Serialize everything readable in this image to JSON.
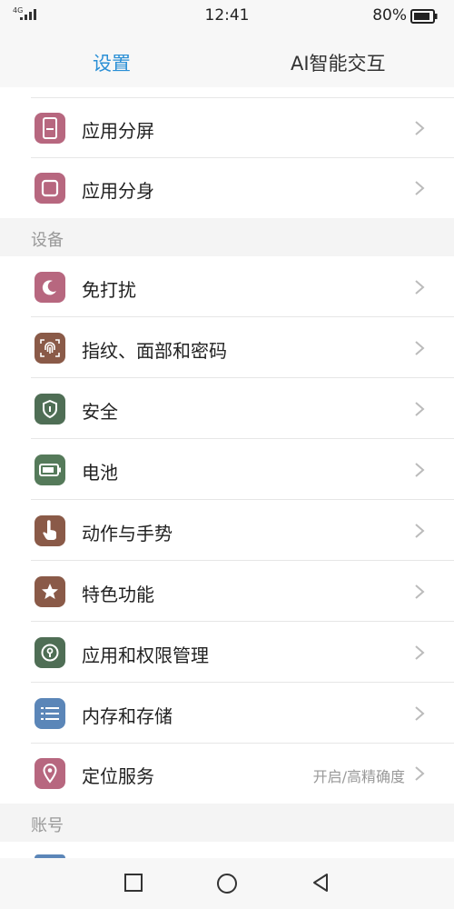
{
  "status_bar": {
    "network": "4G",
    "time": "12:41",
    "battery": "80%"
  },
  "tabs": [
    {
      "label": "设置",
      "active": true
    },
    {
      "label": "AI智能交互",
      "active": false
    }
  ],
  "top_items": [
    {
      "label": "应用分屏",
      "icon": "split-screen-icon",
      "color": "#b7677f"
    },
    {
      "label": "应用分身",
      "icon": "app-clone-icon",
      "color": "#b7677f"
    }
  ],
  "section_device": {
    "title": "设备",
    "items": [
      {
        "label": "免打扰",
        "icon": "moon-icon",
        "color": "#b7677f"
      },
      {
        "label": "指纹、面部和密码",
        "icon": "fingerprint-icon",
        "color": "#8a5a48"
      },
      {
        "label": "安全",
        "icon": "shield-icon",
        "color": "#4f6e55"
      },
      {
        "label": "电池",
        "icon": "battery-icon",
        "color": "#557a5a"
      },
      {
        "label": "动作与手势",
        "icon": "hand-gesture-icon",
        "color": "#8a5a48"
      },
      {
        "label": "特色功能",
        "icon": "star-icon",
        "color": "#8a5a48"
      },
      {
        "label": "应用和权限管理",
        "icon": "lock-icon",
        "color": "#4f6e55"
      },
      {
        "label": "内存和存储",
        "icon": "list-icon",
        "color": "#5b86b8"
      },
      {
        "label": "定位服务",
        "icon": "location-pin-icon",
        "color": "#b7677f",
        "value": "开启/高精确度"
      }
    ]
  },
  "section_account": {
    "title": "账号"
  },
  "nav": {
    "recent": "square-icon",
    "home": "circle-icon",
    "back": "triangle-back-icon"
  }
}
